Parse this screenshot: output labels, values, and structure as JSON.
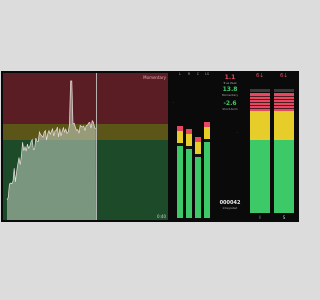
{
  "app": {
    "history_title": "Momentary",
    "history_footer": "0:40"
  },
  "channels": [
    {
      "label": "L",
      "level": 0.63
    },
    {
      "label": "R",
      "level": 0.61
    },
    {
      "label": "C",
      "level": 0.56
    },
    {
      "label": "LS",
      "level": 0.66
    }
  ],
  "readouts": {
    "peak": "1.1",
    "peak_label": "True Peak",
    "momentary": "13.8",
    "momentary_label": "Momentary",
    "short_term": "-2.6",
    "short_term_label": "Short-term",
    "integrated": "000042",
    "integrated_label": "Integrated"
  },
  "loudness_panel": {
    "left_head": "6↓",
    "right_head": "6↓",
    "left_foot": "I",
    "right_foot": "S"
  },
  "colors": {
    "red": "#e8475f",
    "yellow": "#e6cd2a",
    "green": "#3ec969"
  }
}
